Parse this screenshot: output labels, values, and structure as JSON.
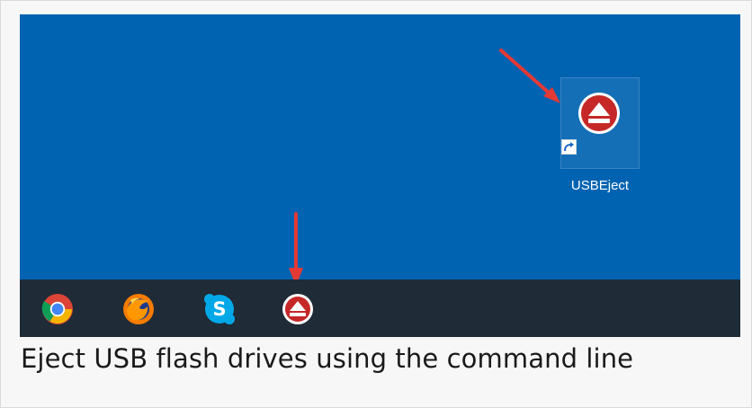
{
  "desktop": {
    "shortcut": {
      "label": "USBEject",
      "icon": "usb-eject-icon",
      "overlay_icon": "shortcut-arrow-icon"
    },
    "annotations": [
      {
        "icon": "red-arrow-icon",
        "color": "#e53935"
      },
      {
        "icon": "red-arrow-icon",
        "color": "#e53935"
      }
    ]
  },
  "taskbar": {
    "items": [
      {
        "icon": "chrome-icon"
      },
      {
        "icon": "firefox-icon"
      },
      {
        "icon": "skype-icon"
      },
      {
        "icon": "usb-eject-icon"
      }
    ]
  },
  "caption": {
    "text": "Eject USB flash drives using the command line"
  },
  "colors": {
    "desktop_background": "#0063b1",
    "taskbar_background": "#1f2b36",
    "eject_red": "#c62828",
    "annotation_red": "#e53935"
  }
}
